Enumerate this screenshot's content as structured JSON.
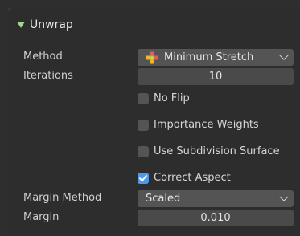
{
  "panel": {
    "title": "Unwrap",
    "method": {
      "label": "Method",
      "value": "Minimum Stretch"
    },
    "iterations": {
      "label": "Iterations",
      "value": "10"
    },
    "checkboxes": [
      {
        "label": "No Flip",
        "checked": false
      },
      {
        "label": "Importance Weights",
        "checked": false
      },
      {
        "label": "Use Subdivision Surface",
        "checked": false
      },
      {
        "label": "Correct Aspect",
        "checked": true
      }
    ],
    "margin_method": {
      "label": "Margin Method",
      "value": "Scaled"
    },
    "margin": {
      "label": "Margin",
      "value": "0.010"
    }
  },
  "colors": {
    "panel_bg": "#2d2d2d",
    "field_bg": "#545454",
    "checkbox_on": "#4e9ae8",
    "triangle": "#a6d68f"
  },
  "icons": {
    "collapse": "triangle-down-icon",
    "method": "minimum-stretch-icon",
    "dropdown": "chevron-down-icon",
    "checked": "checkmark-icon"
  }
}
